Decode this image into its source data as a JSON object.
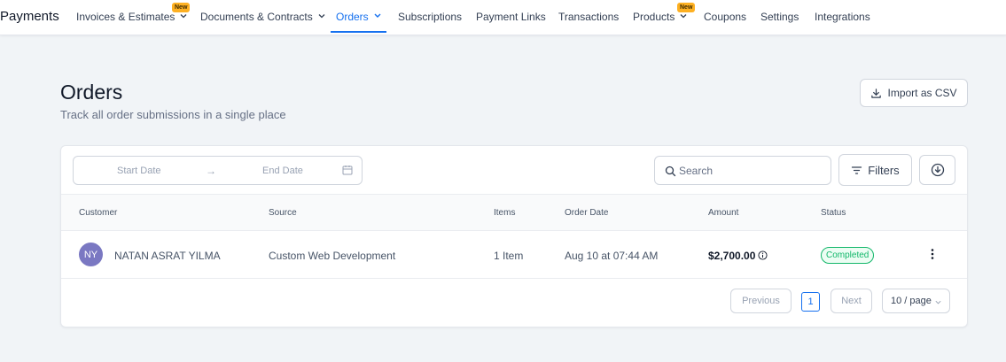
{
  "nav": {
    "brand": "Payments",
    "items": [
      {
        "label": "Invoices & Estimates",
        "dropdown": true,
        "badge": "New"
      },
      {
        "label": "Documents & Contracts",
        "dropdown": true
      },
      {
        "label": "Orders",
        "dropdown": true,
        "active": true
      },
      {
        "label": "Subscriptions"
      },
      {
        "label": "Payment Links"
      },
      {
        "label": "Transactions"
      },
      {
        "label": "Products",
        "dropdown": true,
        "badge": "New"
      },
      {
        "label": "Coupons"
      },
      {
        "label": "Settings"
      },
      {
        "label": "Integrations"
      }
    ]
  },
  "header": {
    "title": "Orders",
    "subtitle": "Track all order submissions in a single place",
    "import_label": "Import as CSV"
  },
  "toolbar": {
    "start_date_placeholder": "Start Date",
    "end_date_placeholder": "End Date",
    "arrow": "→",
    "search_placeholder": "Search",
    "filters_label": "Filters"
  },
  "table": {
    "columns": [
      "Customer",
      "Source",
      "Items",
      "Order Date",
      "Amount",
      "Status"
    ],
    "rows": [
      {
        "initials": "NY",
        "customer": "NATAN ASRAT YILMA",
        "source": "Custom Web Development",
        "items": "1 Item",
        "order_date": "Aug 10 at 07:44 AM",
        "amount": "$2,700.00",
        "status": "Completed"
      }
    ]
  },
  "pagination": {
    "previous": "Previous",
    "current_page": "1",
    "next": "Next",
    "page_size": "10 / page"
  },
  "colors": {
    "accent": "#1570ef",
    "badge": "#fdb022",
    "avatar": "#7a78c2",
    "status_success": "#12b76a"
  },
  "icons": [
    "chevron-down-icon",
    "download-icon",
    "arrow-right-icon",
    "calendar-icon",
    "search-icon",
    "filter-icon",
    "download-circle-icon",
    "info-icon",
    "more-vertical-icon"
  ]
}
